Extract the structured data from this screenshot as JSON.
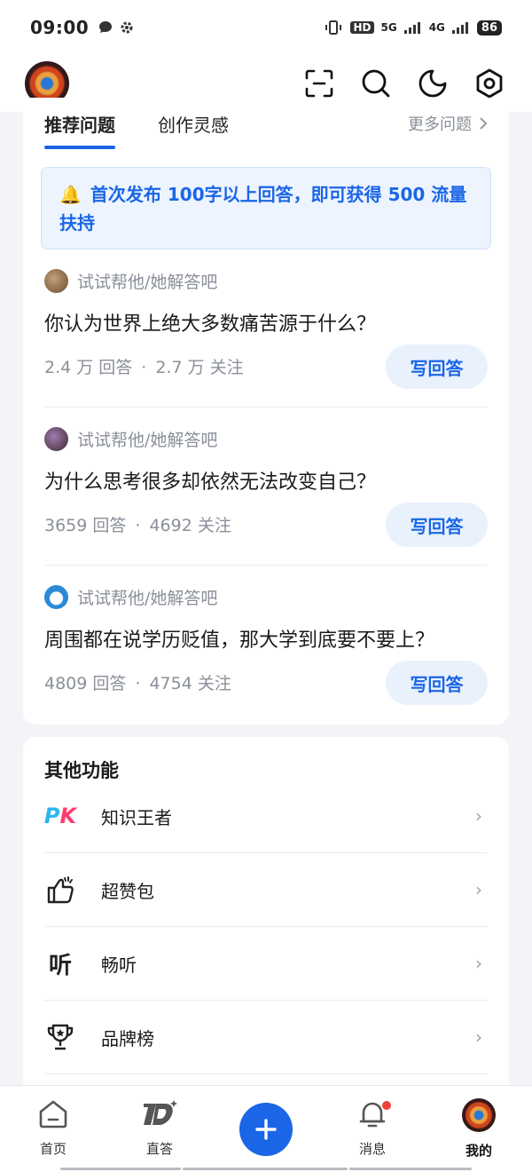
{
  "status_bar": {
    "time": "09:00",
    "battery": "86",
    "network": [
      "HD",
      "5G",
      "4G"
    ]
  },
  "top_bar": {
    "icons": [
      "scan-icon",
      "search-icon",
      "moon-icon",
      "settings-icon"
    ]
  },
  "tabs": {
    "items": [
      "推荐问题",
      "创作灵感"
    ],
    "active_index": 0,
    "more_label": "更多问题"
  },
  "notice": {
    "text": "首次发布 100字以上回答，即可获得 500 流量扶持"
  },
  "questions": [
    {
      "hint": "试试帮他/她解答吧",
      "title": "你认为世界上绝大多数痛苦源于什么？",
      "answers": "2.4 万 回答",
      "follows": "2.7 万 关注",
      "button": "写回答"
    },
    {
      "hint": "试试帮他/她解答吧",
      "title": "为什么思考很多却依然无法改变自己？",
      "answers": "3659 回答",
      "follows": "4692 关注",
      "button": "写回答"
    },
    {
      "hint": "试试帮他/她解答吧",
      "title": "周围都在说学历贬值，那大学到底要不要上？",
      "answers": "4809 回答",
      "follows": "4754 关注",
      "button": "写回答"
    }
  ],
  "other_functions": {
    "title": "其他功能",
    "items": [
      {
        "label": "知识王者",
        "icon": "pk-icon"
      },
      {
        "label": "超赞包",
        "icon": "thumbs-up-icon"
      },
      {
        "label": "畅听",
        "icon": "listen-icon"
      },
      {
        "label": "品牌榜",
        "icon": "trophy-icon"
      }
    ]
  },
  "bottom_nav": {
    "items": [
      "首页",
      "直答",
      "",
      "消息",
      "我的"
    ],
    "active_index": 4
  },
  "colors": {
    "accent": "#1a66e6",
    "notice_bg": "#edf4fe",
    "badge_red": "#f0413a"
  }
}
